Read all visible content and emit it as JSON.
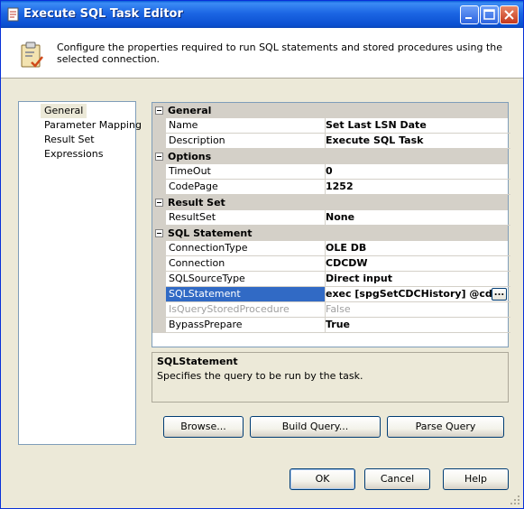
{
  "window": {
    "title": "Execute SQL Task Editor",
    "icon": "sql-task-icon"
  },
  "header": {
    "icon": "clipboard-check-icon",
    "description": "Configure the properties required to run SQL statements and stored procedures using the selected connection."
  },
  "nav": {
    "items": [
      {
        "label": "General",
        "selected": true
      },
      {
        "label": "Parameter Mapping",
        "selected": false
      },
      {
        "label": "Result Set",
        "selected": false
      },
      {
        "label": "Expressions",
        "selected": false
      }
    ]
  },
  "grid": {
    "categories": [
      {
        "label": "General",
        "properties": [
          {
            "name": "Name",
            "value": "Set Last LSN Date"
          },
          {
            "name": "Description",
            "value": "Execute SQL Task"
          }
        ]
      },
      {
        "label": "Options",
        "properties": [
          {
            "name": "TimeOut",
            "value": "0"
          },
          {
            "name": "CodePage",
            "value": "1252"
          }
        ]
      },
      {
        "label": "Result Set",
        "properties": [
          {
            "name": "ResultSet",
            "value": "None"
          }
        ]
      },
      {
        "label": "SQL Statement",
        "properties": [
          {
            "name": "ConnectionType",
            "value": "OLE DB"
          },
          {
            "name": "Connection",
            "value": "CDCDW"
          },
          {
            "name": "SQLSourceType",
            "value": "Direct input"
          },
          {
            "name": "SQLStatement",
            "value": "exec [spgSetCDCHistory] @cdcT",
            "selected": true,
            "ellipsis": "..."
          },
          {
            "name": "IsQueryStoredProcedure",
            "value": "False",
            "disabled": true
          },
          {
            "name": "BypassPrepare",
            "value": "True"
          }
        ]
      }
    ]
  },
  "description_panel": {
    "title": "SQLStatement",
    "text": "Specifies the query to be run by the task."
  },
  "action_buttons": {
    "browse": "Browse...",
    "build_query": "Build Query...",
    "parse_query": "Parse Query"
  },
  "dialog_buttons": {
    "ok": "OK",
    "cancel": "Cancel",
    "help": "Help"
  },
  "colors": {
    "titlebar": "#0a4fd0",
    "selection": "#316ac5",
    "dialog_bg": "#ece9d8"
  }
}
